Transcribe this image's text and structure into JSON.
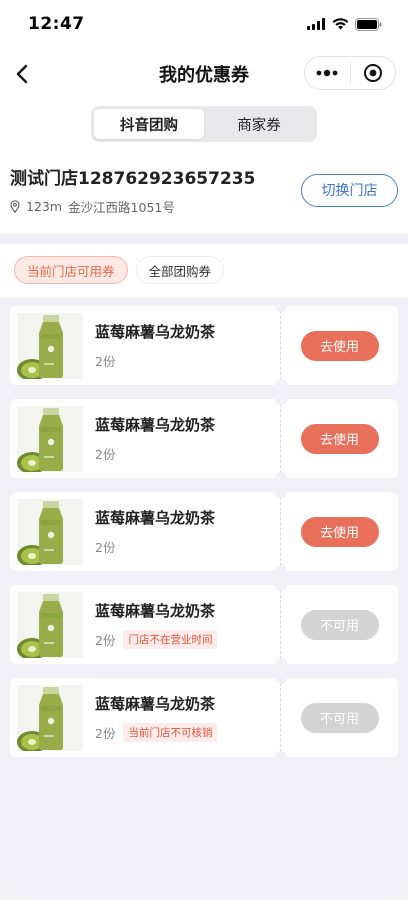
{
  "status_bar": {
    "time": "12:47"
  },
  "nav": {
    "title": "我的优惠券"
  },
  "segment": {
    "tabs": [
      "抖音团购",
      "商家券"
    ],
    "active": 0
  },
  "store": {
    "name": "测试门店128762923657235",
    "distance": "123m",
    "address": "金沙江西路1051号",
    "switch_label": "切换门店"
  },
  "filters": [
    "当前门店可用券",
    "全部团购券"
  ],
  "colors": {
    "accent": "#e8705b",
    "link_blue": "#3f74cf",
    "disabled": "#d3d3d3"
  },
  "coupons": [
    {
      "name": "蓝莓麻薯乌龙奶茶",
      "qty": "2份",
      "tag": "",
      "button": "去使用",
      "enabled": true
    },
    {
      "name": "蓝莓麻薯乌龙奶茶",
      "qty": "2份",
      "tag": "",
      "button": "去使用",
      "enabled": true
    },
    {
      "name": "蓝莓麻薯乌龙奶茶",
      "qty": "2份",
      "tag": "",
      "button": "去使用",
      "enabled": true
    },
    {
      "name": "蓝莓麻薯乌龙奶茶",
      "qty": "2份",
      "tag": "门店不在营业时间",
      "button": "不可用",
      "enabled": false
    },
    {
      "name": "蓝莓麻薯乌龙奶茶",
      "qty": "2份",
      "tag": "当前门店不可核销",
      "button": "不可用",
      "enabled": false
    }
  ]
}
